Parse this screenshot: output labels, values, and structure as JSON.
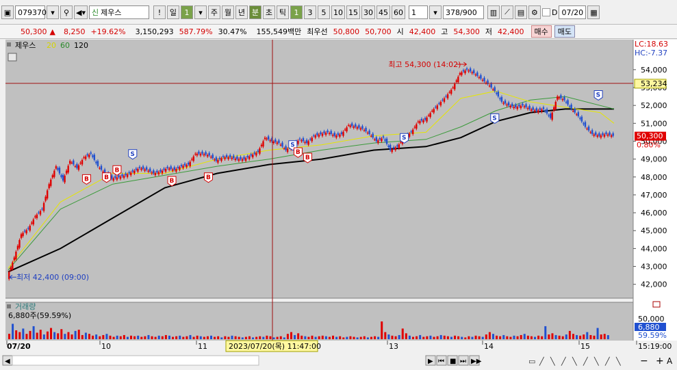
{
  "toolbar": {
    "code": "079370",
    "new_badge": "신",
    "stock_name": "제우스",
    "alert": "!",
    "period_day": "일",
    "period_day_num": "1",
    "periods": [
      "주",
      "월",
      "년"
    ],
    "minute": "분",
    "second": "초",
    "tick": "틱",
    "intervals": [
      "1",
      "3",
      "5",
      "10",
      "15",
      "30",
      "45",
      "60"
    ],
    "count": "1",
    "range": "378",
    "range_total": "/900",
    "date_check_label": "D",
    "date_value": "07/20"
  },
  "info_bar": {
    "price": "50,300",
    "change_arrow": "▲",
    "change": "8,250",
    "change_pct": "+19.62%",
    "volume": "3,150,293",
    "volume_ratio": "587.79%",
    "turnover": "30.47%",
    "amount": "155,549백만",
    "best_ask_label": "최우선",
    "best_ask": "50,800",
    "best_bid": "50,700",
    "open_label": "시",
    "open": "42,400",
    "high_label": "고",
    "high": "54,300",
    "low_label": "저",
    "low": "42,400",
    "sell_button": "매수",
    "buy_button": "매도"
  },
  "chart_data": {
    "type": "line",
    "legend": [
      {
        "name": "제우스",
        "color": "#000000"
      },
      {
        "name": "20",
        "color": "#d4d400"
      },
      {
        "name": "60",
        "color": "#2a8a2a"
      },
      {
        "name": "120",
        "color": "#000000"
      }
    ],
    "colors": {
      "up": "#e00000",
      "down": "#2050d0",
      "ma20": "#e6e600",
      "ma60": "#3a9a3a",
      "ma120": "#000000",
      "background": "#c0c0c0"
    },
    "ylim": [
      41300,
      55600
    ],
    "y_ticks": [
      "54,000",
      "53,000",
      "52,000",
      "51,000",
      "50,000",
      "49,000",
      "48,000",
      "47,000",
      "46,000",
      "45,000",
      "44,000",
      "43,000",
      "42,000"
    ],
    "y_tick_values": [
      54000,
      53000,
      52000,
      51000,
      50000,
      49000,
      48000,
      47000,
      46000,
      45000,
      44000,
      43000,
      42000
    ],
    "x_labels": [
      "07/20",
      "10",
      "11",
      "13",
      "14",
      "15",
      "15:19:00"
    ],
    "price_path": [
      [
        0,
        42400
      ],
      [
        8,
        43500
      ],
      [
        16,
        44800
      ],
      [
        24,
        45100
      ],
      [
        32,
        45800
      ],
      [
        40,
        46200
      ],
      [
        48,
        47600
      ],
      [
        56,
        48600
      ],
      [
        64,
        47800
      ],
      [
        72,
        48900
      ],
      [
        80,
        48500
      ],
      [
        88,
        49100
      ],
      [
        96,
        49300
      ],
      [
        104,
        48600
      ],
      [
        112,
        48200
      ],
      [
        120,
        47900
      ],
      [
        128,
        48000
      ],
      [
        136,
        48100
      ],
      [
        144,
        48300
      ],
      [
        152,
        48500
      ],
      [
        160,
        48400
      ],
      [
        168,
        48200
      ],
      [
        176,
        48300
      ],
      [
        184,
        48500
      ],
      [
        192,
        48400
      ],
      [
        200,
        48600
      ],
      [
        208,
        48700
      ],
      [
        216,
        49300
      ],
      [
        224,
        49300
      ],
      [
        232,
        49200
      ],
      [
        240,
        48900
      ],
      [
        248,
        49100
      ],
      [
        256,
        49100
      ],
      [
        264,
        49000
      ],
      [
        272,
        49000
      ],
      [
        280,
        49200
      ],
      [
        288,
        49400
      ],
      [
        296,
        50200
      ],
      [
        304,
        50000
      ],
      [
        312,
        49900
      ],
      [
        320,
        49500
      ],
      [
        328,
        49800
      ],
      [
        336,
        50100
      ],
      [
        344,
        49900
      ],
      [
        352,
        50300
      ],
      [
        360,
        50400
      ],
      [
        368,
        50500
      ],
      [
        376,
        50300
      ],
      [
        384,
        50400
      ],
      [
        392,
        50900
      ],
      [
        400,
        50800
      ],
      [
        408,
        50700
      ],
      [
        416,
        50400
      ],
      [
        424,
        50000
      ],
      [
        432,
        50200
      ],
      [
        440,
        49500
      ],
      [
        448,
        49700
      ],
      [
        456,
        50200
      ],
      [
        464,
        50500
      ],
      [
        472,
        51100
      ],
      [
        480,
        51200
      ],
      [
        488,
        51700
      ],
      [
        496,
        52100
      ],
      [
        504,
        52500
      ],
      [
        512,
        53000
      ],
      [
        520,
        53800
      ],
      [
        528,
        54000
      ],
      [
        536,
        53800
      ],
      [
        544,
        53500
      ],
      [
        552,
        53200
      ],
      [
        560,
        52800
      ],
      [
        568,
        52200
      ],
      [
        576,
        52000
      ],
      [
        584,
        51900
      ],
      [
        592,
        52000
      ],
      [
        600,
        51800
      ],
      [
        608,
        51700
      ],
      [
        616,
        51800
      ],
      [
        624,
        51300
      ],
      [
        632,
        52500
      ],
      [
        640,
        52300
      ],
      [
        648,
        51800
      ],
      [
        656,
        51400
      ],
      [
        664,
        50800
      ],
      [
        672,
        50400
      ],
      [
        680,
        50300
      ],
      [
        688,
        50400
      ],
      [
        696,
        50300
      ]
    ],
    "ma20_path": [
      [
        0,
        42900
      ],
      [
        60,
        46600
      ],
      [
        120,
        48200
      ],
      [
        180,
        48200
      ],
      [
        240,
        49000
      ],
      [
        300,
        49500
      ],
      [
        360,
        49800
      ],
      [
        420,
        50300
      ],
      [
        480,
        50500
      ],
      [
        520,
        52400
      ],
      [
        560,
        52800
      ],
      [
        600,
        52200
      ],
      [
        640,
        51900
      ],
      [
        680,
        51600
      ],
      [
        696,
        51000
      ]
    ],
    "ma60_path": [
      [
        0,
        42800
      ],
      [
        60,
        46200
      ],
      [
        120,
        47600
      ],
      [
        180,
        48100
      ],
      [
        240,
        48600
      ],
      [
        300,
        49000
      ],
      [
        360,
        49500
      ],
      [
        420,
        49900
      ],
      [
        480,
        50100
      ],
      [
        520,
        50800
      ],
      [
        560,
        51700
      ],
      [
        600,
        52300
      ],
      [
        640,
        52500
      ],
      [
        696,
        51800
      ]
    ],
    "ma120_path": [
      [
        0,
        42700
      ],
      [
        60,
        44000
      ],
      [
        120,
        45700
      ],
      [
        180,
        47400
      ],
      [
        240,
        48200
      ],
      [
        300,
        48700
      ],
      [
        360,
        49000
      ],
      [
        420,
        49500
      ],
      [
        480,
        49700
      ],
      [
        520,
        50200
      ],
      [
        560,
        51100
      ],
      [
        600,
        51600
      ],
      [
        640,
        51800
      ],
      [
        696,
        51800
      ]
    ],
    "cursor_value_label": "53,234",
    "cursor_value": 53234,
    "current_label": "50,300",
    "current_value": 50300,
    "current_pct": "0.80%",
    "lc_label": "LC:18.63",
    "hc_label": "HC:-7.37",
    "high_annotation": "최고 54,300 (14:02)",
    "high_value": 54300,
    "low_annotation": "최저 42,400 (09:00)",
    "low_value": 42400,
    "signals": [
      {
        "t": "B",
        "x": 90,
        "v": 47900
      },
      {
        "t": "B",
        "x": 113,
        "v": 48000
      },
      {
        "t": "B",
        "x": 125,
        "v": 48400
      },
      {
        "t": "S",
        "x": 143,
        "v": 49300
      },
      {
        "t": "B",
        "x": 188,
        "v": 47800
      },
      {
        "t": "B",
        "x": 230,
        "v": 48000
      },
      {
        "t": "S",
        "x": 327,
        "v": 49800
      },
      {
        "t": "B",
        "x": 333,
        "v": 49400
      },
      {
        "t": "B",
        "x": 344,
        "v": 49100
      },
      {
        "t": "S",
        "x": 455,
        "v": 50200
      },
      {
        "t": "S",
        "x": 559,
        "v": 51300
      },
      {
        "t": "S",
        "x": 678,
        "v": 52600
      }
    ],
    "cursor_time_label": "2023/07/20(목)  11:47:00",
    "volume_title": "거래량",
    "volume_value": "6,880주(59.59%)",
    "volume_axis": "50,000",
    "volume_current": "6,880",
    "volume_pct": "59.59%",
    "volume_series": [
      [
        0,
        9200
      ],
      [
        4,
        26000
      ],
      [
        8,
        15000
      ],
      [
        12,
        12000
      ],
      [
        16,
        18000
      ],
      [
        20,
        9000
      ],
      [
        24,
        14000
      ],
      [
        28,
        22000
      ],
      [
        32,
        11000
      ],
      [
        36,
        16000
      ],
      [
        40,
        8000
      ],
      [
        44,
        13000
      ],
      [
        48,
        19000
      ],
      [
        52,
        12000
      ],
      [
        56,
        10000
      ],
      [
        60,
        17000
      ],
      [
        64,
        9000
      ],
      [
        68,
        12000
      ],
      [
        72,
        8000
      ],
      [
        76,
        14000
      ],
      [
        80,
        16000
      ],
      [
        84,
        7000
      ],
      [
        88,
        11000
      ],
      [
        92,
        9000
      ],
      [
        96,
        6000
      ],
      [
        100,
        8000
      ],
      [
        104,
        5000
      ],
      [
        108,
        7000
      ],
      [
        112,
        9000
      ],
      [
        116,
        6000
      ],
      [
        120,
        4000
      ],
      [
        124,
        6000
      ],
      [
        128,
        5000
      ],
      [
        132,
        7000
      ],
      [
        136,
        4000
      ],
      [
        140,
        6000
      ],
      [
        144,
        5000
      ],
      [
        148,
        6000
      ],
      [
        152,
        4000
      ],
      [
        156,
        5000
      ],
      [
        160,
        7000
      ],
      [
        164,
        5000
      ],
      [
        168,
        4000
      ],
      [
        172,
        6000
      ],
      [
        176,
        5000
      ],
      [
        180,
        7000
      ],
      [
        184,
        6000
      ],
      [
        188,
        4000
      ],
      [
        192,
        5000
      ],
      [
        196,
        6000
      ],
      [
        200,
        4000
      ],
      [
        204,
        5000
      ],
      [
        208,
        7000
      ],
      [
        212,
        4000
      ],
      [
        216,
        6000
      ],
      [
        220,
        5000
      ],
      [
        224,
        4000
      ],
      [
        228,
        5000
      ],
      [
        232,
        6000
      ],
      [
        236,
        4000
      ],
      [
        240,
        5000
      ],
      [
        244,
        3000
      ],
      [
        248,
        5000
      ],
      [
        252,
        4000
      ],
      [
        256,
        6000
      ],
      [
        260,
        5000
      ],
      [
        264,
        4000
      ],
      [
        268,
        3000
      ],
      [
        272,
        4000
      ],
      [
        276,
        5000
      ],
      [
        280,
        3000
      ],
      [
        284,
        4000
      ],
      [
        288,
        5000
      ],
      [
        292,
        4000
      ],
      [
        296,
        6000
      ],
      [
        300,
        5000
      ],
      [
        304,
        3000
      ],
      [
        308,
        4000
      ],
      [
        312,
        5000
      ],
      [
        316,
        3000
      ],
      [
        320,
        9000
      ],
      [
        324,
        12000
      ],
      [
        328,
        7000
      ],
      [
        332,
        10000
      ],
      [
        336,
        6000
      ],
      [
        340,
        5000
      ],
      [
        344,
        4000
      ],
      [
        348,
        6000
      ],
      [
        352,
        4000
      ],
      [
        356,
        5000
      ],
      [
        360,
        6000
      ],
      [
        364,
        5000
      ],
      [
        368,
        4000
      ],
      [
        372,
        6000
      ],
      [
        376,
        4000
      ],
      [
        380,
        5000
      ],
      [
        384,
        3000
      ],
      [
        388,
        4000
      ],
      [
        392,
        5000
      ],
      [
        396,
        4000
      ],
      [
        400,
        3000
      ],
      [
        404,
        4000
      ],
      [
        408,
        5000
      ],
      [
        412,
        3000
      ],
      [
        416,
        4000
      ],
      [
        420,
        5000
      ],
      [
        424,
        4000
      ],
      [
        428,
        30000
      ],
      [
        432,
        12000
      ],
      [
        436,
        8000
      ],
      [
        440,
        6000
      ],
      [
        444,
        5000
      ],
      [
        448,
        7000
      ],
      [
        452,
        18000
      ],
      [
        456,
        10000
      ],
      [
        460,
        6000
      ],
      [
        464,
        4000
      ],
      [
        468,
        5000
      ],
      [
        472,
        7000
      ],
      [
        476,
        4000
      ],
      [
        480,
        5000
      ],
      [
        484,
        6000
      ],
      [
        488,
        4000
      ],
      [
        492,
        5000
      ],
      [
        496,
        7000
      ],
      [
        500,
        6000
      ],
      [
        504,
        5000
      ],
      [
        508,
        4000
      ],
      [
        512,
        6000
      ],
      [
        516,
        5000
      ],
      [
        520,
        4000
      ],
      [
        524,
        3000
      ],
      [
        528,
        5000
      ],
      [
        532,
        4000
      ],
      [
        536,
        6000
      ],
      [
        540,
        5000
      ],
      [
        544,
        4000
      ],
      [
        548,
        8000
      ],
      [
        552,
        12000
      ],
      [
        556,
        9000
      ],
      [
        560,
        6000
      ],
      [
        564,
        5000
      ],
      [
        568,
        7000
      ],
      [
        572,
        5000
      ],
      [
        576,
        4000
      ],
      [
        580,
        6000
      ],
      [
        584,
        5000
      ],
      [
        588,
        7000
      ],
      [
        592,
        9000
      ],
      [
        596,
        6000
      ],
      [
        600,
        5000
      ],
      [
        604,
        4000
      ],
      [
        608,
        6000
      ],
      [
        612,
        5000
      ],
      [
        616,
        22000
      ],
      [
        620,
        8000
      ],
      [
        624,
        10000
      ],
      [
        628,
        7000
      ],
      [
        632,
        6000
      ],
      [
        636,
        5000
      ],
      [
        640,
        8000
      ],
      [
        644,
        14000
      ],
      [
        648,
        9000
      ],
      [
        652,
        7000
      ],
      [
        656,
        6000
      ],
      [
        660,
        8000
      ],
      [
        664,
        12000
      ],
      [
        668,
        7000
      ],
      [
        672,
        6000
      ],
      [
        676,
        19000
      ],
      [
        680,
        8000
      ],
      [
        684,
        9000
      ],
      [
        688,
        6880
      ]
    ]
  }
}
